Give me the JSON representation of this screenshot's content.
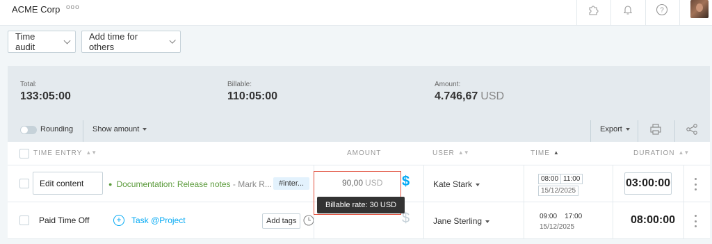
{
  "workspace": {
    "name": "ACME Corp",
    "more": "ooo"
  },
  "toolbar": {
    "time_audit": "Time audit",
    "add_time_others": "Add time for others"
  },
  "summary": {
    "total_label": "Total:",
    "total_value": "133:05:00",
    "billable_label": "Billable:",
    "billable_value": "110:05:00",
    "amount_label": "Amount:",
    "amount_value": "4.746,67",
    "amount_unit": "USD",
    "rounding_label": "Rounding",
    "show_amount_label": "Show amount",
    "export_label": "Export"
  },
  "table": {
    "headers": {
      "time_entry": "TIME ENTRY",
      "amount": "AMOUNT",
      "user": "USER",
      "time": "TIME",
      "duration": "DURATION"
    },
    "rows": [
      {
        "description": "Edit content",
        "project": "Documentation: Release notes",
        "task_suffix": "- Mark R...",
        "tag": "#inter...",
        "amount": "90,00",
        "amount_unit": "USD",
        "user": "Kate Stark",
        "start": "08:00",
        "end": "11:00",
        "date": "15/12/2025",
        "duration": "03:00:00"
      },
      {
        "description": "Paid Time Off",
        "project_link": "Task @Project",
        "add_tags": "Add tags",
        "user": "Jane Sterling",
        "start": "09:00",
        "end": "17:00",
        "date": "15/12/2025",
        "duration": "08:00:00"
      }
    ]
  },
  "tooltip": {
    "text": "Billable rate: 30 USD"
  },
  "colors": {
    "accent": "#03a9f4",
    "project_green": "#5a9a3a",
    "highlight_red": "#e14f3c",
    "panel_bg": "#e4eaee"
  }
}
